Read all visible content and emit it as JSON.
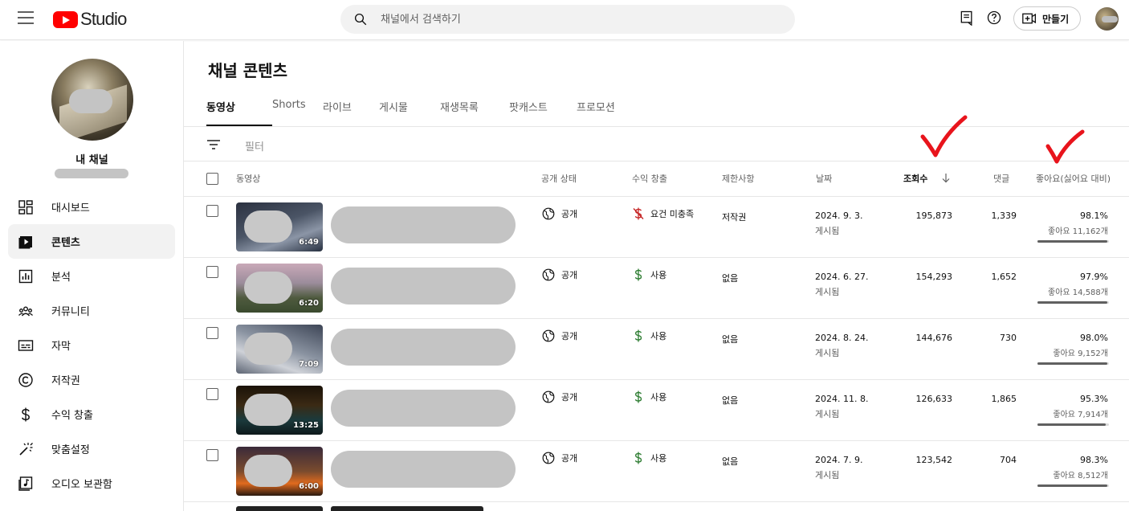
{
  "topbar": {
    "logo_text": "Studio",
    "search_placeholder": "채널에서 검색하기",
    "create_label": "만들기"
  },
  "sidebar": {
    "channel_name": "내 채널",
    "items": [
      {
        "label": "대시보드",
        "icon": "dashboard-icon"
      },
      {
        "label": "콘텐츠",
        "icon": "content-icon",
        "active": true
      },
      {
        "label": "분석",
        "icon": "analytics-icon"
      },
      {
        "label": "커뮤니티",
        "icon": "community-icon"
      },
      {
        "label": "자막",
        "icon": "subtitles-icon"
      },
      {
        "label": "저작권",
        "icon": "copyright-icon"
      },
      {
        "label": "수익 창출",
        "icon": "dollar-icon"
      },
      {
        "label": "맞춤설정",
        "icon": "magic-wand-icon"
      },
      {
        "label": "오디오 보관함",
        "icon": "audio-library-icon"
      }
    ]
  },
  "main": {
    "title": "채널 콘텐츠",
    "tabs": [
      "동영상",
      "Shorts",
      "라이브",
      "게시물",
      "재생목록",
      "팟캐스트",
      "프로모션"
    ],
    "filter_label": "필터",
    "columns": {
      "video": "동영상",
      "visibility": "공개 상태",
      "monetization": "수익 창출",
      "restrictions": "제한사항",
      "date": "날짜",
      "views": "조회수",
      "comments": "댓글",
      "likes": "좋아요(싫어요 대비)"
    },
    "rows": [
      {
        "duration": "6:49",
        "visibility": "공개",
        "monetization": "요건 미충족",
        "restrictions": "저작권",
        "date": "2024. 9. 3.",
        "date_sub": "게시됨",
        "views": "195,873",
        "comments": "1,339",
        "like_pct": "98.1%",
        "like_count": "좋아요 11,162개",
        "like_ratio": 0.981
      },
      {
        "duration": "6:20",
        "visibility": "공개",
        "monetization": "사용",
        "restrictions": "없음",
        "date": "2024. 6. 27.",
        "date_sub": "게시됨",
        "views": "154,293",
        "comments": "1,652",
        "like_pct": "97.9%",
        "like_count": "좋아요 14,588개",
        "like_ratio": 0.979
      },
      {
        "duration": "7:09",
        "visibility": "공개",
        "monetization": "사용",
        "restrictions": "없음",
        "date": "2024. 8. 24.",
        "date_sub": "게시됨",
        "views": "144,676",
        "comments": "730",
        "like_pct": "98.0%",
        "like_count": "좋아요 9,152개",
        "like_ratio": 0.98
      },
      {
        "duration": "13:25",
        "visibility": "공개",
        "monetization": "사용",
        "restrictions": "없음",
        "date": "2024. 11. 8.",
        "date_sub": "게시됨",
        "views": "126,633",
        "comments": "1,865",
        "like_pct": "95.3%",
        "like_count": "좋아요 7,914개",
        "like_ratio": 0.953
      },
      {
        "duration": "6:00",
        "visibility": "공개",
        "monetization": "사용",
        "restrictions": "없음",
        "date": "2024. 7. 9.",
        "date_sub": "게시됨",
        "views": "123,542",
        "comments": "704",
        "like_pct": "98.3%",
        "like_count": "좋아요 8,512개",
        "like_ratio": 0.983
      }
    ]
  },
  "colors": {
    "brand_red": "#ff0000",
    "annotation_red": "#e8141c",
    "money_green": "#2e7d32"
  }
}
